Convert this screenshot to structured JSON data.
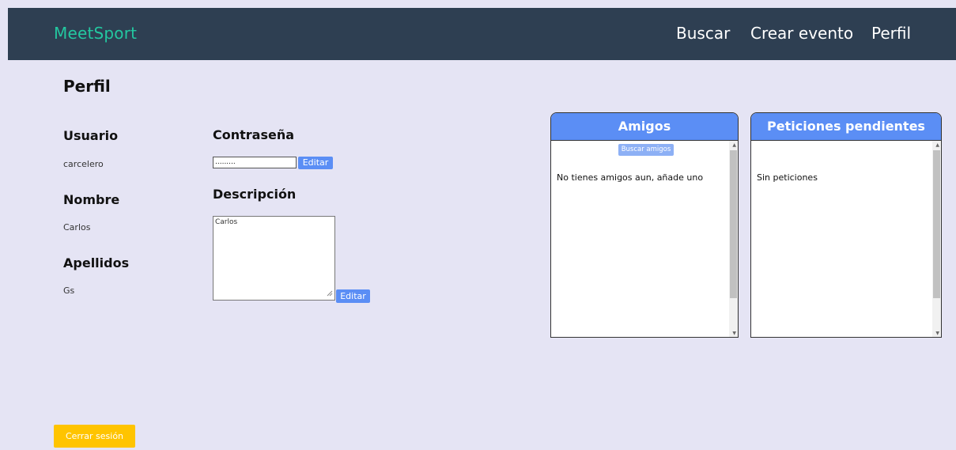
{
  "header": {
    "brand": "MeetSport",
    "nav": {
      "search": "Buscar",
      "create_event": "Crear evento",
      "profile": "Perfil"
    }
  },
  "page": {
    "title": "Perfil"
  },
  "profile": {
    "username_label": "Usuario",
    "username_value": "carcelero",
    "name_label": "Nombre",
    "name_value": "Carlos",
    "surname_label": "Apellidos",
    "surname_value": "Gs",
    "password_label": "Contraseña",
    "password_value": ".........",
    "password_edit": "Editar",
    "description_label": "Descripción",
    "description_value": "Carlos",
    "description_edit": "Editar"
  },
  "friends_panel": {
    "title": "Amigos",
    "search_button": "Buscar amigos",
    "empty_text": "No tienes amigos aun, añade uno"
  },
  "requests_panel": {
    "title": "Peticiones pendientes",
    "empty_text": "Sin peticiones"
  },
  "logout": "Cerrar sesión",
  "colors": {
    "header_bg": "#2e3f52",
    "brand": "#23c7a0",
    "page_bg": "#e5e4f4",
    "accent_blue": "#5b8ef5",
    "logout_yellow": "#ffc400"
  }
}
